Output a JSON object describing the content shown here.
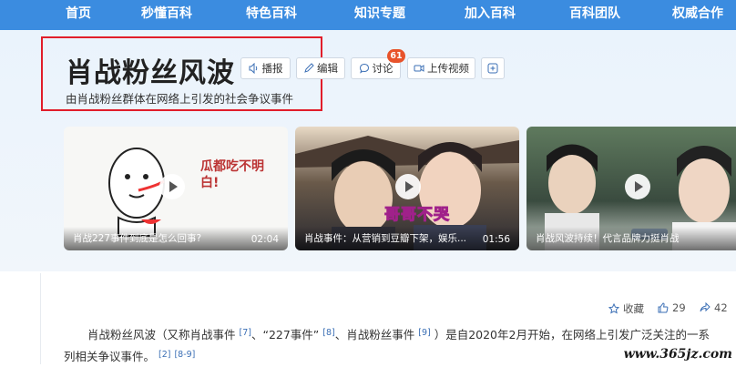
{
  "nav": {
    "items": [
      "首页",
      "秒懂百科",
      "特色百科",
      "知识专题",
      "加入百科",
      "百科团队",
      "权威合作"
    ]
  },
  "header": {
    "title": "肖战粉丝风波",
    "subtitle": "由肖战粉丝群体在网络上引发的社会争议事件",
    "actions": {
      "play": "播报",
      "edit": "编辑",
      "discuss": "讨论",
      "discuss_count": "61",
      "upload": "上传视频"
    }
  },
  "videos": [
    {
      "title": "肖战227事件到底是怎么回事?",
      "duration": "02:04",
      "handwriting": "瓜都吃不明白!"
    },
    {
      "title": "肖战事件：从营销到豆瓣下架，娱乐...",
      "duration": "01:56",
      "caption": "哥哥不哭"
    },
    {
      "title": "肖战风波持续！代言品牌力挺肖战",
      "duration": ""
    }
  ],
  "stats": {
    "favorite_label": "收藏",
    "likes": "29",
    "shares": "42"
  },
  "article": {
    "prefix": "肖战粉丝风波（又称肖战事件",
    "ref1": "[7]",
    "mid1": "、“227事件”",
    "ref2": "[8]",
    "mid2": "、肖战粉丝事件",
    "ref3": "[9]",
    "rest": "）是自2020年2月开始，在网络上引发广泛关注的一系列相关争议事件。",
    "ref4": "[2]",
    "ref5": "[8-9]"
  },
  "watermark": "www.365jz.com",
  "colors": {
    "nav_bg": "#3b8ce0",
    "highlight_box": "#e11d2a",
    "badge": "#e8532b",
    "link": "#3b6fb5"
  }
}
